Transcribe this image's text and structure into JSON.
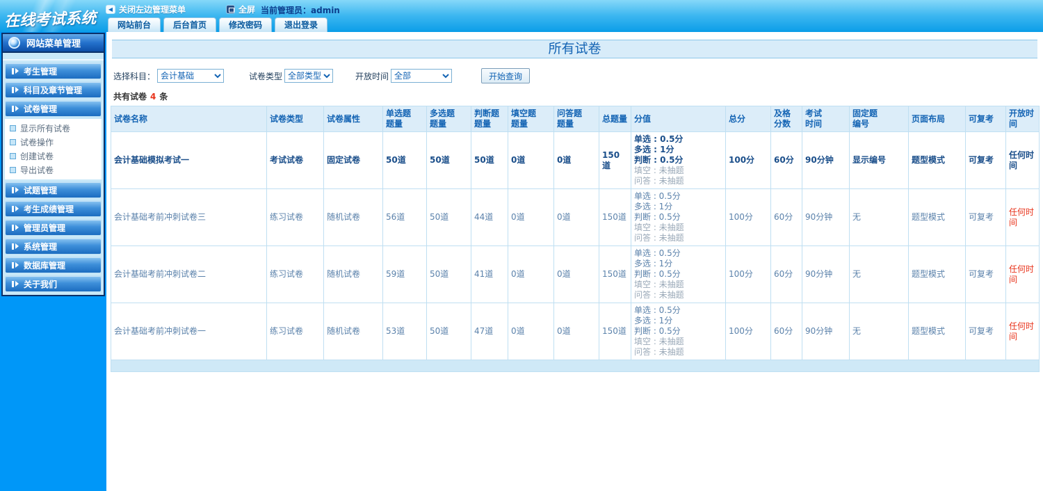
{
  "colors": {
    "accent_blue": "#1464b4",
    "sidebar_blue": "#0097f8",
    "alert_red": "#e8341c"
  },
  "header": {
    "logo": "在线考试系统",
    "close_menu_label": "关闭左边管理菜单",
    "close_menu_icon": "◀",
    "fullscreen_label": "全屏",
    "admin_label": "当前管理员：admin",
    "tabs": [
      "网站前台",
      "后台首页",
      "修改密码",
      "退出登录"
    ]
  },
  "sidebar": {
    "title": "网站菜单管理",
    "groups": [
      {
        "label": "考生管理"
      },
      {
        "label": "科目及章节管理"
      },
      {
        "label": "试卷管理",
        "children": [
          "显示所有试卷",
          "试卷操作",
          "创建试卷",
          "导出试卷"
        ]
      },
      {
        "label": "试题管理"
      },
      {
        "label": "考生成绩管理"
      },
      {
        "label": "管理员管理"
      },
      {
        "label": "系统管理"
      },
      {
        "label": "数据库管理"
      },
      {
        "label": "关于我们"
      }
    ]
  },
  "main": {
    "title": "所有试卷",
    "filters": {
      "subject_label": "选择科目：",
      "subject_value": "会计基础",
      "type_label": "试卷类型",
      "type_value": "全部类型",
      "time_label": "开放时间",
      "time_value": "全部",
      "search_button": "开始查询"
    },
    "count_prefix": "共有试卷",
    "count_value": "4",
    "count_suffix": "条",
    "table": {
      "headers": [
        [
          "试卷名称"
        ],
        [
          "试卷类型"
        ],
        [
          "试卷属性"
        ],
        [
          "单选题",
          "题量"
        ],
        [
          "多选题",
          "题量"
        ],
        [
          "判断题",
          "题量"
        ],
        [
          "填空题",
          "题量"
        ],
        [
          "问答题",
          "题量"
        ],
        [
          "总题量"
        ],
        [
          "分值"
        ],
        [
          "总分"
        ],
        [
          "及格",
          "分数"
        ],
        [
          "考试",
          "时间"
        ],
        [
          "固定题",
          "编号"
        ],
        [
          "页面布局"
        ],
        [
          "可复考"
        ],
        [
          "开放时间"
        ]
      ],
      "rows": [
        {
          "name": "会计基础模拟考试一",
          "type": "考试试卷",
          "attr": "固定试卷",
          "q_single": "50道",
          "q_multi": "50道",
          "q_judge": "50道",
          "q_fill": "0道",
          "q_qa": "0道",
          "q_total": "150道",
          "scores": [
            {
              "text": "单选 : 0.5分",
              "muted": false
            },
            {
              "text": "多选 : 1分",
              "muted": false
            },
            {
              "text": "判断 : 0.5分",
              "muted": false
            },
            {
              "text": "填空 : 未抽题",
              "muted": true
            },
            {
              "text": "问答 : 未抽题",
              "muted": true
            }
          ],
          "score_total": "100分",
          "score_pass": "60分",
          "duration": "90分钟",
          "fixed_no": "显示编号",
          "page_layout": "题型模式",
          "retake": "可复考",
          "open_time": "任何时间",
          "emphasis": true
        },
        {
          "name": "会计基础考前冲刺试卷三",
          "type": "练习试卷",
          "attr": "随机试卷",
          "q_single": "56道",
          "q_multi": "50道",
          "q_judge": "44道",
          "q_fill": "0道",
          "q_qa": "0道",
          "q_total": "150道",
          "scores": [
            {
              "text": "单选 : 0.5分",
              "muted": false
            },
            {
              "text": "多选 : 1分",
              "muted": false
            },
            {
              "text": "判断 : 0.5分",
              "muted": false
            },
            {
              "text": "填空 : 未抽题",
              "muted": true
            },
            {
              "text": "问答 : 未抽题",
              "muted": true
            }
          ],
          "score_total": "100分",
          "score_pass": "60分",
          "duration": "90分钟",
          "fixed_no": "无",
          "page_layout": "题型模式",
          "retake": "可复考",
          "open_time": "任何时间",
          "emphasis": false
        },
        {
          "name": "会计基础考前冲刺试卷二",
          "type": "练习试卷",
          "attr": "随机试卷",
          "q_single": "59道",
          "q_multi": "50道",
          "q_judge": "41道",
          "q_fill": "0道",
          "q_qa": "0道",
          "q_total": "150道",
          "scores": [
            {
              "text": "单选 : 0.5分",
              "muted": false
            },
            {
              "text": "多选 : 1分",
              "muted": false
            },
            {
              "text": "判断 : 0.5分",
              "muted": false
            },
            {
              "text": "填空 : 未抽题",
              "muted": true
            },
            {
              "text": "问答 : 未抽题",
              "muted": true
            }
          ],
          "score_total": "100分",
          "score_pass": "60分",
          "duration": "90分钟",
          "fixed_no": "无",
          "page_layout": "题型模式",
          "retake": "可复考",
          "open_time": "任何时间",
          "emphasis": false
        },
        {
          "name": "会计基础考前冲刺试卷一",
          "type": "练习试卷",
          "attr": "随机试卷",
          "q_single": "53道",
          "q_multi": "50道",
          "q_judge": "47道",
          "q_fill": "0道",
          "q_qa": "0道",
          "q_total": "150道",
          "scores": [
            {
              "text": "单选 : 0.5分",
              "muted": false
            },
            {
              "text": "多选 : 1分",
              "muted": false
            },
            {
              "text": "判断 : 0.5分",
              "muted": false
            },
            {
              "text": "填空 : 未抽题",
              "muted": true
            },
            {
              "text": "问答 : 未抽题",
              "muted": true
            }
          ],
          "score_total": "100分",
          "score_pass": "60分",
          "duration": "90分钟",
          "fixed_no": "无",
          "page_layout": "题型模式",
          "retake": "可复考",
          "open_time": "任何时间",
          "emphasis": false
        }
      ]
    }
  }
}
